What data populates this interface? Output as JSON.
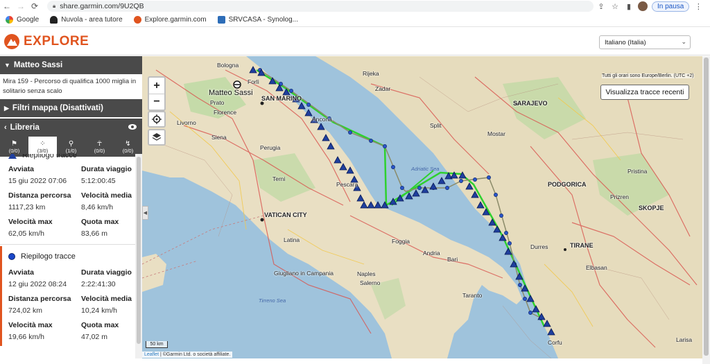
{
  "browser": {
    "url": "share.garmin.com/9U2QB",
    "status_pill": "In pausa",
    "bookmarks": [
      {
        "label": "Google"
      },
      {
        "label": "Nuvola - area tutore"
      },
      {
        "label": "Explore.garmin.com"
      },
      {
        "label": "SRVCASA - Synolog..."
      }
    ]
  },
  "app": {
    "logo_text": "EXPLORE",
    "brand_color": "#e0541f",
    "language": "Italiano (Italia)"
  },
  "sidebar": {
    "user_name": "Matteo Sassi",
    "description": "Mira 159 - Percorso di qualifica 1000 miglia in solitario senza scalo",
    "filters_label": "Filtri mappa (Disattivati)",
    "library_label": "Libreria",
    "tabs": [
      {
        "count": "(0/0)",
        "icon": "flag-icon"
      },
      {
        "count": "(3/0)",
        "icon": "footprints-icon"
      },
      {
        "count": "(1/0)",
        "icon": "runner-icon"
      },
      {
        "count": "(0/0)",
        "icon": "person-icon"
      },
      {
        "count": "(0/0)",
        "icon": "trail-icon"
      }
    ],
    "tracks": [
      {
        "title": "Riepilogo tracce",
        "icon": "triangle-icon",
        "stats": {
          "started_label": "Avviata",
          "started": "15 giu 2022 07:06",
          "duration_label": "Durata viaggio",
          "duration": "5:12:00:45",
          "distance_label": "Distanza percorsa",
          "distance": "1117,23 km",
          "avg_speed_label": "Velocità media",
          "avg_speed": "8,46 km/h",
          "max_speed_label": "Velocità max",
          "max_speed": "62,05 km/h",
          "max_alt_label": "Quota max",
          "max_alt": "83,66 m"
        }
      },
      {
        "title": "Riepilogo tracce",
        "icon": "circle-icon",
        "stats": {
          "started_label": "Avviata",
          "started": "12 giu 2022 08:24",
          "duration_label": "Durata viaggio",
          "duration": "2:22:41:30",
          "distance_label": "Distanza percorsa",
          "distance": "724,02 km",
          "avg_speed_label": "Velocità media",
          "avg_speed": "10,24 km/h",
          "max_speed_label": "Velocità max",
          "max_speed": "19,66 km/h",
          "max_alt_label": "Quota max",
          "max_alt": "47,02 m"
        }
      }
    ]
  },
  "map": {
    "timezone_note": "Tutti gli orari sono Europe/Berlin. (UTC +2)",
    "recent_tracks_button": "Visualizza tracce recenti",
    "zoom_in": "+",
    "zoom_out": "−",
    "scale_label": "50 km",
    "attribution_link": "Leaflet",
    "attribution_text": " | ©Garmin Ltd. o società affiliate.",
    "user_marker": "Matteo Sassi",
    "track_colors": {
      "route": "#2ed12e",
      "triangles": "#1f3f9e",
      "dots": "#2a55c8"
    },
    "labels": {
      "bologna": "Bologna",
      "forli": "Forlì",
      "san_marino": "SAN MARINO",
      "prato": "Prato",
      "florence": "Florence",
      "livorno": "Livorno",
      "siena": "Siena",
      "perugia": "Perugia",
      "ancona": "Ancona",
      "terni": "Terni",
      "pescara": "Pescara",
      "vatican": "VATICAN CITY",
      "latina": "Latina",
      "foggia": "Foggia",
      "andria": "Andria",
      "bari": "Bari",
      "giugliano": "Giugliano in Campania",
      "naples": "Naples",
      "salerno": "Salerno",
      "taranto": "Taranto",
      "tyrrhenian": "Tirreno Sea",
      "adriatic": "Adriatic Sea",
      "split": "Split",
      "sarajevo": "SARAJEVO",
      "mostar": "Mostar",
      "podgorica": "PODGORICA",
      "skopje": "SKOPJE",
      "tirane": "TIRANE",
      "durres": "Durres",
      "pristina": "Pristina",
      "prizren": "Prizren",
      "larisa": "Larisa",
      "rijeka": "Rijeka",
      "zadar": "Zadar",
      "elbasan": "Elbasan",
      "corfu": "Corfu"
    }
  }
}
